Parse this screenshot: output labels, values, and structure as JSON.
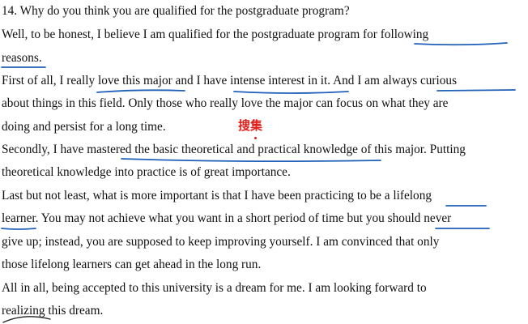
{
  "document": {
    "lines": [
      "14. Why do you think you are qualified for the postgraduate program?",
      "Well, to be honest, I believe I am qualified for the postgraduate program for following",
      "reasons.",
      "First of all, I really love this major and I have intense interest in it. And I am always curious",
      "about things in this field. Only those who really love the major can focus on what they are",
      "doing and persist for a long time.",
      "Secondly, I have mastered the basic theoretical and practical knowledge of this major. Putting",
      "theoretical knowledge into practice is of great importance.",
      "Last but not least, what is more important is that I have been practicing to be a lifelong",
      "learner. You may not achieve what you want in a short period of time but you should never",
      "give up; instead, you are supposed to keep improving yourself. I am convinced that only",
      "those lifelong learners can get ahead in the long run.",
      "All in all, being accepted to this university is a dream for me. I am looking forward to",
      "realizing this dream."
    ],
    "handwritten_note": "搜集"
  },
  "colors": {
    "text": "#111111",
    "underline_ink": "#1f5fb8",
    "note_ink": "#e0201b"
  }
}
